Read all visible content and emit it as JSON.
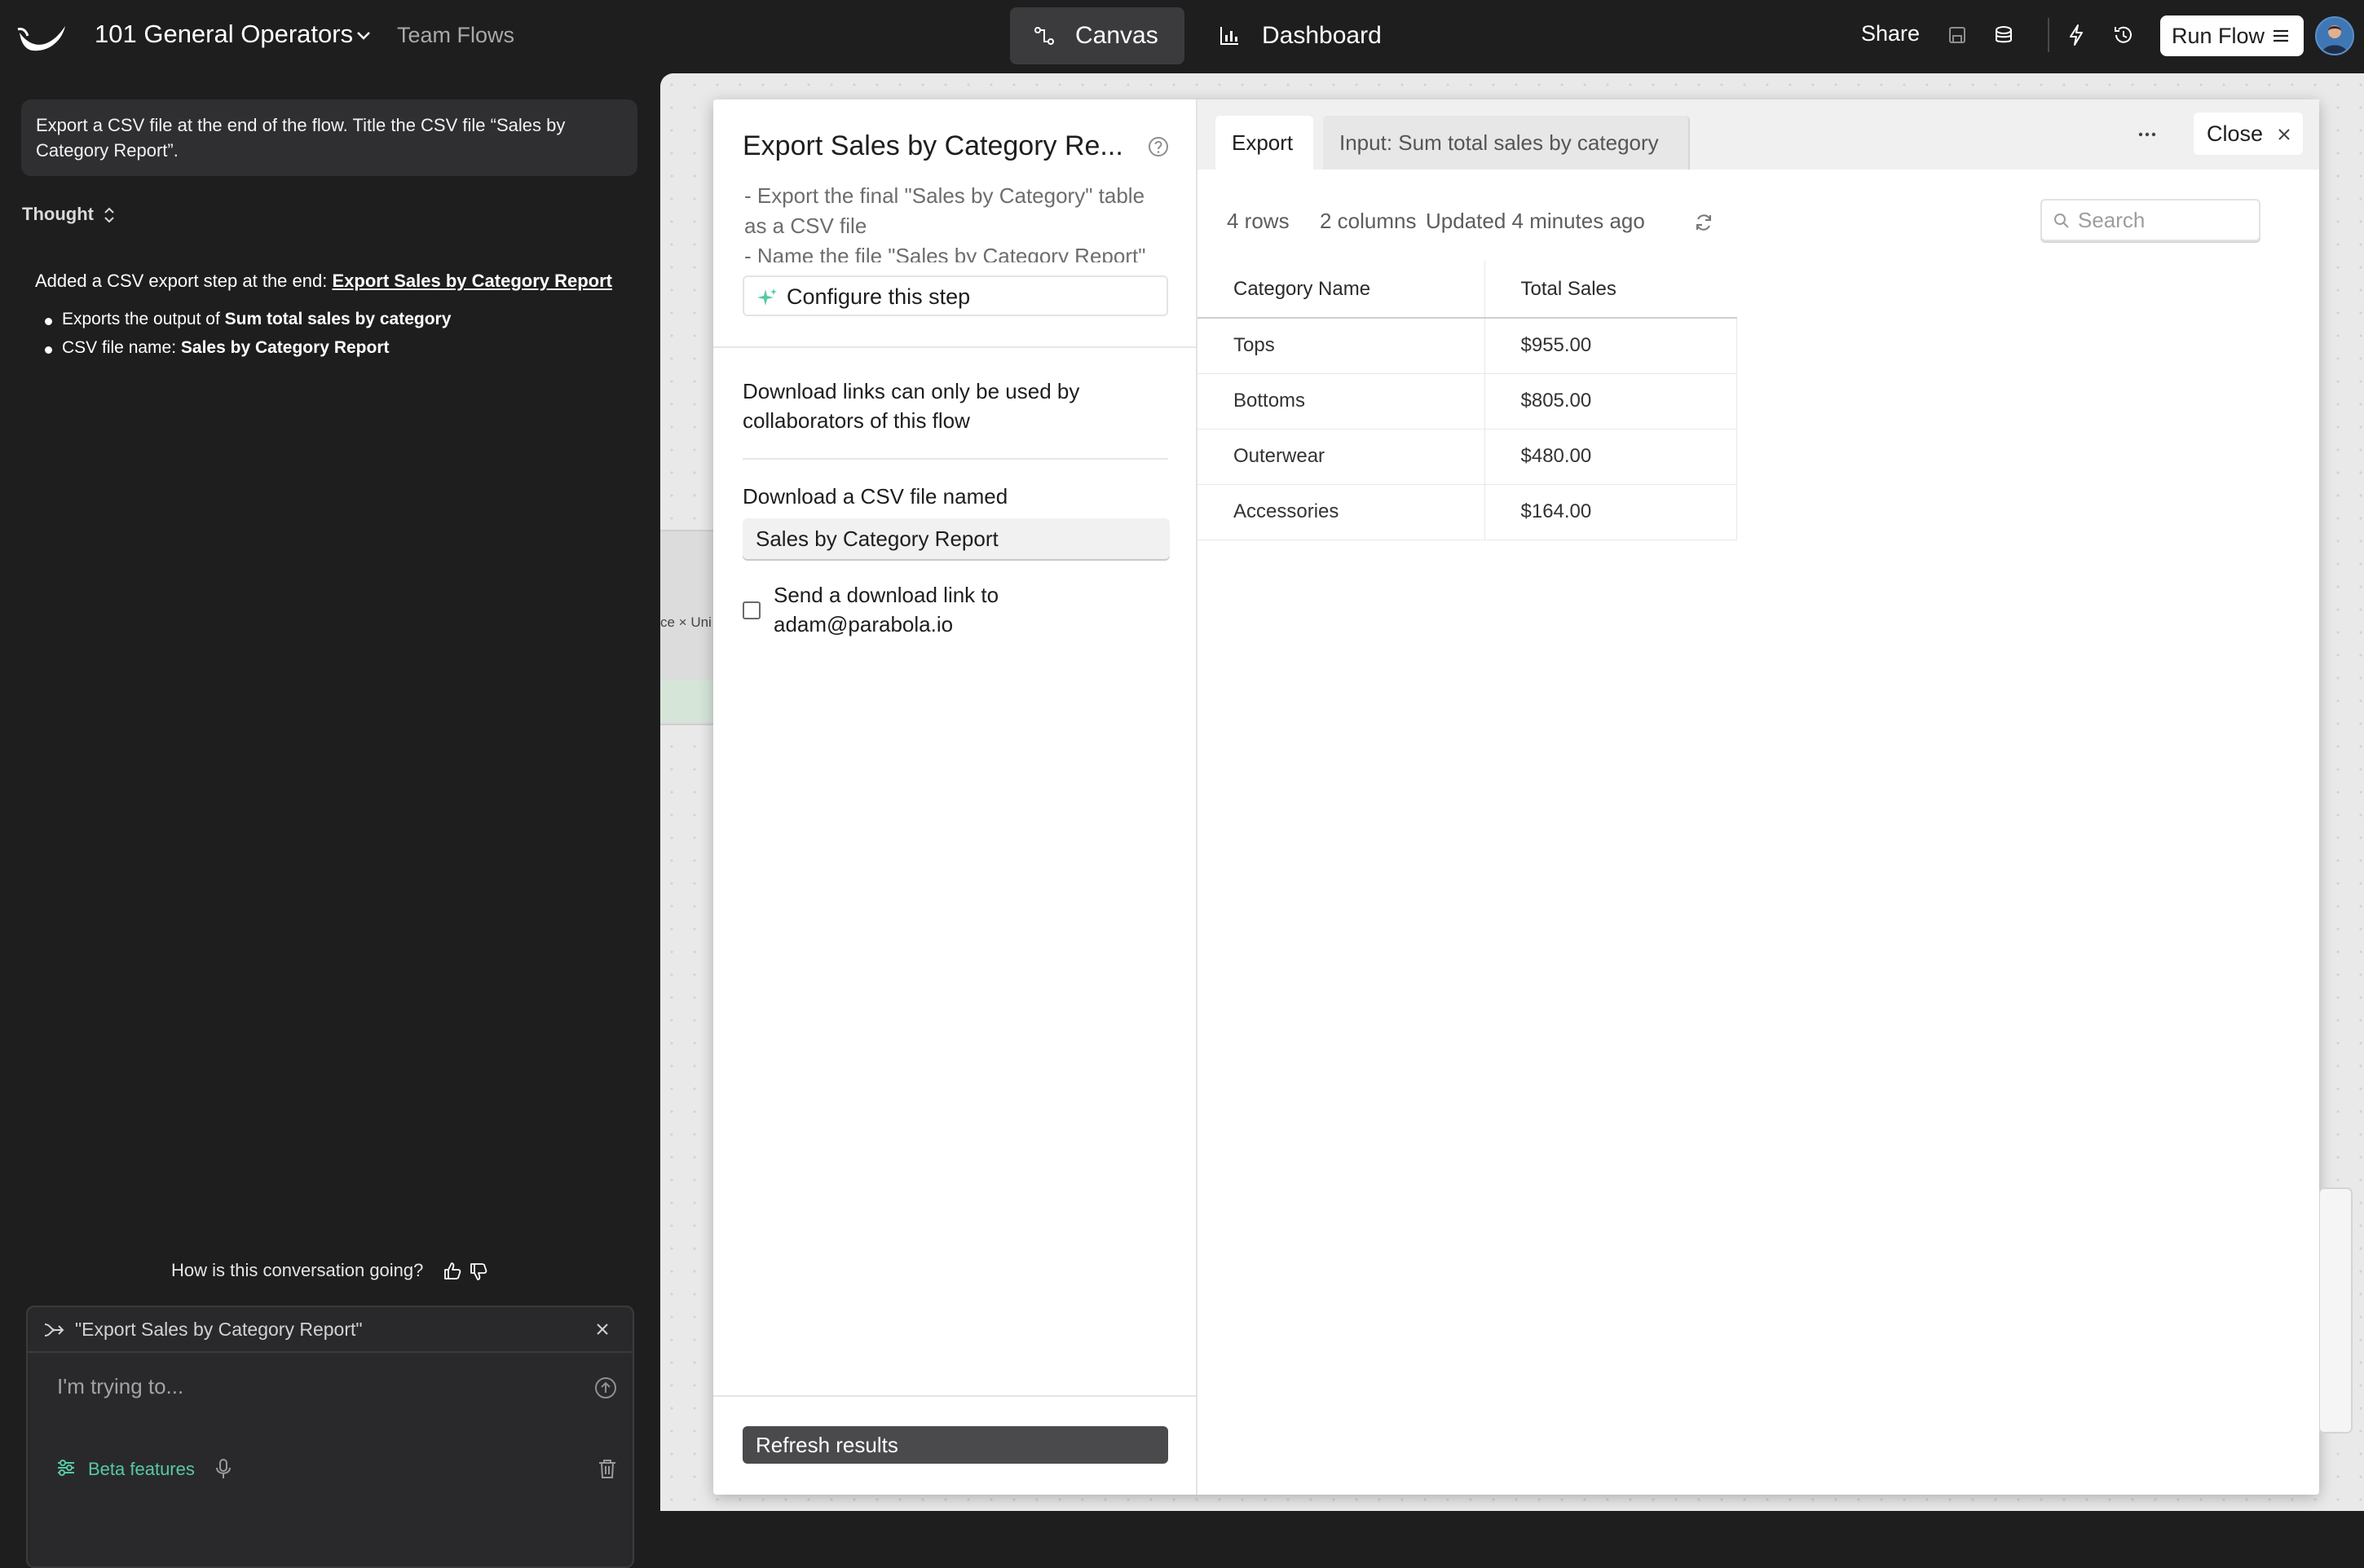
{
  "topbar": {
    "flow_name": "101 General Operators",
    "team_flows": "Team Flows",
    "tabs": [
      {
        "label": "Canvas",
        "icon": "flow-icon",
        "active": true
      },
      {
        "label": "Dashboard",
        "icon": "bar-chart-icon",
        "active": false
      }
    ],
    "share": "Share",
    "run_flow": "Run Flow"
  },
  "assistant": {
    "prompt": "Export a CSV file at the end of the flow. Title the CSV file “Sales by Category Report”.",
    "thought_label": "Thought",
    "answer_prefix": "Added a CSV export step at the end: ",
    "answer_link": "Export Sales by Category Report",
    "bullets": [
      {
        "prefix": "Exports the output of ",
        "bold": "Sum total sales by category"
      },
      {
        "prefix": "CSV file name: ",
        "bold": "Sales by Category Report"
      }
    ],
    "feedback": "How is this conversation going?",
    "context_chip": "\"Export Sales by Category Report\"",
    "input_placeholder": "I'm trying to...",
    "beta_label": "Beta features"
  },
  "canvas": {
    "partial_node_text": "ce × Uni"
  },
  "step": {
    "title": "Export Sales by Category Re...",
    "description": [
      "- Export the final \"Sales by Category\" table as a CSV file",
      "- Name the file \"Sales by Category Report\""
    ],
    "configure_label": "Configure this step",
    "info": "Download links can only be used by collaborators of this flow",
    "download_label": "Download a CSV file named",
    "file_name": "Sales by Category Report",
    "send_link_label": "Send a download link to adam@parabola.io",
    "refresh_label": "Refresh results"
  },
  "results": {
    "tabs": [
      {
        "label": "Export",
        "active": true
      },
      {
        "label": "Input: Sum total sales by category",
        "active": false
      }
    ],
    "close_label": "Close",
    "rows_count": "4 rows",
    "columns_count": "2 columns",
    "updated": "Updated 4 minutes ago",
    "search_placeholder": "Search",
    "columns": [
      "Category Name",
      "Total Sales"
    ],
    "rows": [
      [
        "Tops",
        "$955.00"
      ],
      [
        "Bottoms",
        "$805.00"
      ],
      [
        "Outerwear",
        "$480.00"
      ],
      [
        "Accessories",
        "$164.00"
      ]
    ]
  },
  "colors": {
    "background": "#1e1e1f",
    "accent_green": "#57c9a3",
    "canvas": "#e9e9e9"
  }
}
